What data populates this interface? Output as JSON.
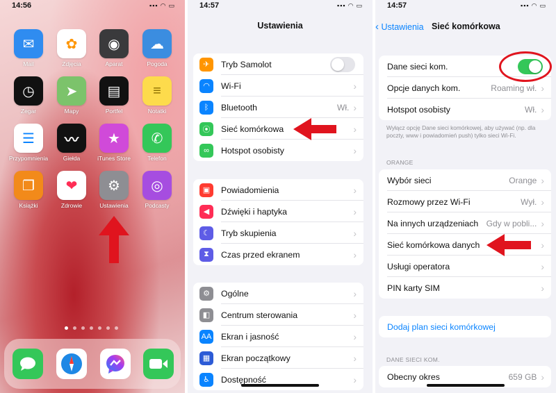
{
  "home": {
    "time": "14:56",
    "apps": [
      {
        "label": "Mail",
        "icon": "mail-icon",
        "color": "#2f8cf0"
      },
      {
        "label": "Zdjęcia",
        "icon": "photos-icon",
        "color": "#ffffff"
      },
      {
        "label": "Aparat",
        "icon": "camera-icon",
        "color": "#3a3a3c"
      },
      {
        "label": "Pogoda",
        "icon": "weather-icon",
        "color": "#3b8de0"
      },
      {
        "label": "Zegar",
        "icon": "clock-icon",
        "color": "#111111"
      },
      {
        "label": "Mapy",
        "icon": "maps-icon",
        "color": "#7cc36b"
      },
      {
        "label": "Portfel",
        "icon": "wallet-icon",
        "color": "#111111"
      },
      {
        "label": "Notatki",
        "icon": "notes-icon",
        "color": "#fddb4c"
      },
      {
        "label": "Przypomnienia",
        "icon": "reminders-icon",
        "color": "#ffffff"
      },
      {
        "label": "Giełda",
        "icon": "stocks-icon",
        "color": "#111111"
      },
      {
        "label": "iTunes Store",
        "icon": "star-icon",
        "color": "#d04ad9"
      },
      {
        "label": "Telefon",
        "icon": "phone-icon",
        "color": "#34c759"
      },
      {
        "label": "Książki",
        "icon": "book-icon",
        "color": "#f28a1a"
      },
      {
        "label": "Zdrowie",
        "icon": "heart-icon",
        "color": "#ffffff"
      },
      {
        "label": "Ustawienia",
        "icon": "gear-icon",
        "color": "#8e8e93"
      },
      {
        "label": "Podcasty",
        "icon": "podcast-icon",
        "color": "#a64de0"
      }
    ],
    "dock": [
      {
        "icon": "messages-icon",
        "color": "#34c759"
      },
      {
        "icon": "safari-icon",
        "color": "#1e88e5"
      },
      {
        "icon": "messenger-icon",
        "color": "#ffffff"
      },
      {
        "icon": "facetime-icon",
        "color": "#34c759"
      }
    ]
  },
  "settings": {
    "time": "14:57",
    "title": "Ustawienia",
    "group1": [
      {
        "label": "Tryb Samolot",
        "icon": "airplane-icon",
        "color": "#ff9500",
        "toggle": false
      },
      {
        "label": "Wi-Fi",
        "icon": "wifi-icon",
        "color": "#0a84ff"
      },
      {
        "label": "Bluetooth",
        "icon": "bluetooth-icon",
        "color": "#0a84ff",
        "value": "Wł."
      },
      {
        "label": "Sieć komórkowa",
        "icon": "antenna-icon",
        "color": "#34c759"
      },
      {
        "label": "Hotspot osobisty",
        "icon": "hotspot-icon",
        "color": "#34c759"
      }
    ],
    "group2": [
      {
        "label": "Powiadomienia",
        "icon": "bell-icon",
        "color": "#ff3b30"
      },
      {
        "label": "Dźwięki i haptyka",
        "icon": "speaker-icon",
        "color": "#ff2d55"
      },
      {
        "label": "Tryb skupienia",
        "icon": "moon-icon",
        "color": "#5e5ce6"
      },
      {
        "label": "Czas przed ekranem",
        "icon": "hourglass-icon",
        "color": "#5e5ce6"
      }
    ],
    "group3": [
      {
        "label": "Ogólne",
        "icon": "gear-icon",
        "color": "#8e8e93"
      },
      {
        "label": "Centrum sterowania",
        "icon": "switches-icon",
        "color": "#8e8e93"
      },
      {
        "label": "Ekran i jasność",
        "icon": "aa-icon",
        "color": "#0a84ff"
      },
      {
        "label": "Ekran początkowy",
        "icon": "grid-icon",
        "color": "#2c5bd6"
      },
      {
        "label": "Dostępność",
        "icon": "accessibility-icon",
        "color": "#0a84ff"
      }
    ]
  },
  "cellular": {
    "time": "14:57",
    "back_label": "Ustawienia",
    "title": "Sieć komórkowa",
    "group1": [
      {
        "label": "Dane sieci kom.",
        "toggle": true
      },
      {
        "label": "Opcje danych kom.",
        "value": "Roaming wł."
      },
      {
        "label": "Hotspot osobisty",
        "value": "Wł."
      }
    ],
    "footnote": "Wyłącz opcję Dane sieci komórkowej, aby używać (np. dla poczty, www i powiadomień push) tylko sieci Wi-Fi.",
    "carrier_header": "ORANGE",
    "group2": [
      {
        "label": "Wybór sieci",
        "value": "Orange"
      },
      {
        "label": "Rozmowy przez Wi-Fi",
        "value": "Wył."
      },
      {
        "label": "Na innych urządzeniach",
        "value": "Gdy w pobli..."
      },
      {
        "label": "Sieć komórkowa danych",
        "value": ""
      },
      {
        "label": "Usługi operatora",
        "value": ""
      },
      {
        "label": "PIN karty SIM",
        "value": ""
      }
    ],
    "add_plan": "Dodaj plan sieci komórkowej",
    "data_header": "DANE SIECI KOM.",
    "group3": [
      {
        "label": "Obecny okres",
        "value": "659 GB"
      }
    ]
  }
}
